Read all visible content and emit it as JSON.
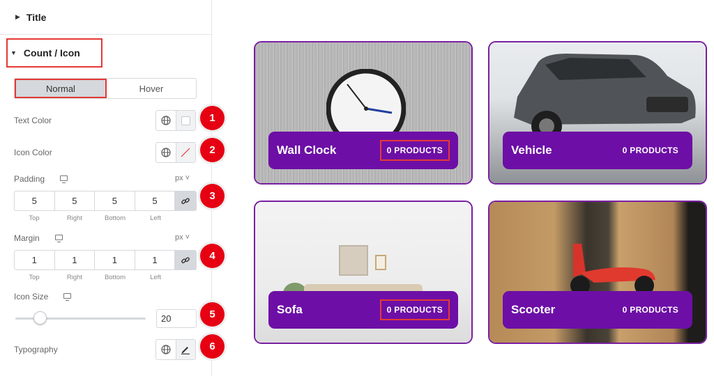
{
  "panel": {
    "title_section": "Title",
    "count_section": "Count / Icon",
    "tabs": [
      "Normal",
      "Hover"
    ],
    "labels": {
      "text_color": "Text Color",
      "icon_color": "Icon Color",
      "padding": "Padding",
      "margin": "Margin",
      "icon_size": "Icon Size",
      "typography": "Typography"
    },
    "units": {
      "padding": "px ˅",
      "margin": "px ˅"
    },
    "padding": {
      "top": "5",
      "right": "5",
      "bottom": "5",
      "left": "5"
    },
    "margin": {
      "top": "1",
      "right": "1",
      "bottom": "1",
      "left": "1"
    },
    "dim_labels": {
      "top": "Top",
      "right": "Right",
      "bottom": "Bottom",
      "left": "Left"
    },
    "icon_size_value": "20",
    "icon_size_fraction": 0.2,
    "badges": [
      "1",
      "2",
      "3",
      "4",
      "5",
      "6"
    ]
  },
  "cards": [
    {
      "name": "Wall Clock",
      "count": "0 PRODUCTS"
    },
    {
      "name": "Vehicle",
      "count": "0 PRODUCTS"
    },
    {
      "name": "Sofa",
      "count": "0 PRODUCTS"
    },
    {
      "name": "Scooter",
      "count": "0 PRODUCTS"
    }
  ],
  "colors": {
    "accent_purple": "#6d0fa6",
    "card_border": "#7a1fa2",
    "highlight_red": "#e53935",
    "badge_red": "#e60012"
  }
}
